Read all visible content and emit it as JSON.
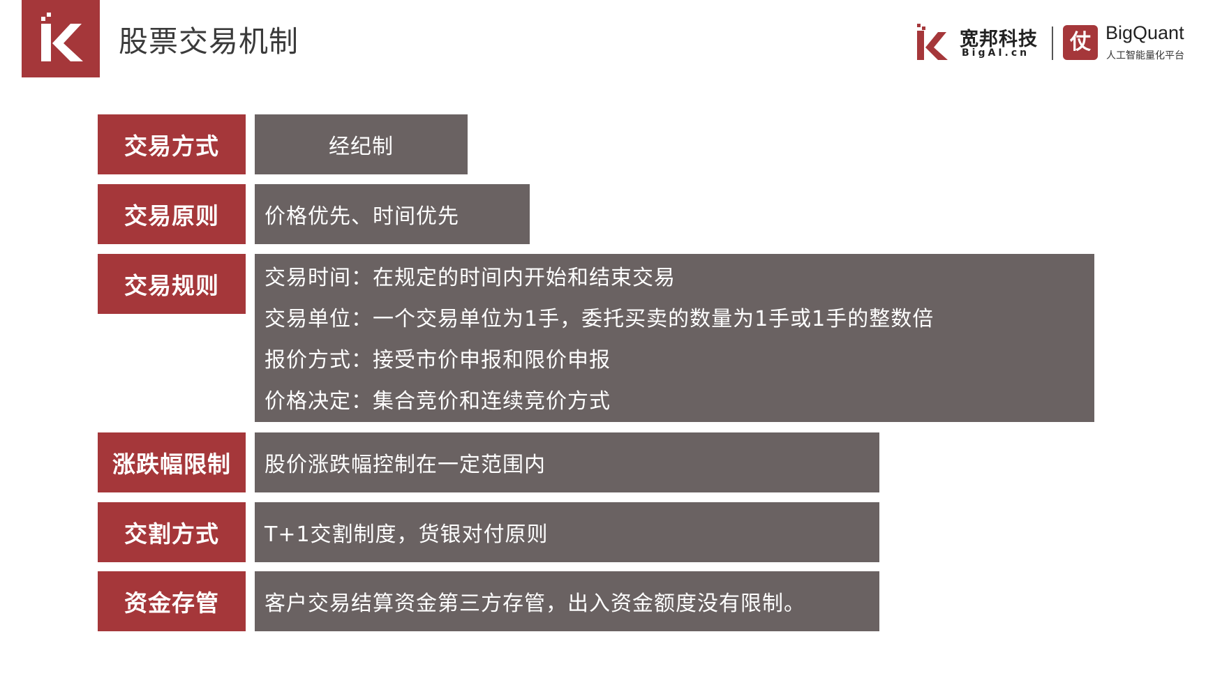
{
  "header": {
    "title": "股票交易机制",
    "brand": {
      "name_cn": "宽邦科技",
      "name_en": "BigAI.cn",
      "product_icon_text": "仗",
      "product_name": "BigQuant",
      "product_tagline": "人工智能量化平台"
    }
  },
  "rows": [
    {
      "label": "交易方式",
      "value": "经纪制"
    },
    {
      "label": "交易原则",
      "value": "价格优先、时间优先"
    },
    {
      "label": "交易规则",
      "lines": [
        "交易时间：在规定的时间内开始和结束交易",
        "交易单位：一个交易单位为1手，委托买卖的数量为1手或1手的整数倍",
        "报价方式：接受市价申报和限价申报",
        "价格决定：集合竞价和连续竞价方式"
      ]
    },
    {
      "label": "涨跌幅限制",
      "value": "股价涨跌幅控制在一定范围内"
    },
    {
      "label": "交割方式",
      "value": "T+1交割制度，货银对付原则"
    },
    {
      "label": "资金存管",
      "value": "客户交易结算资金第三方存管，出入资金额度没有限制。"
    }
  ],
  "colors": {
    "accent_red": "#a5373a",
    "value_gray": "#6a6262",
    "text_white": "#ffffff",
    "title_dark": "#3a3a3a"
  },
  "icons": [
    "bigai-k-logo-icon",
    "bigai-brand-icon",
    "bigquant-icon"
  ]
}
